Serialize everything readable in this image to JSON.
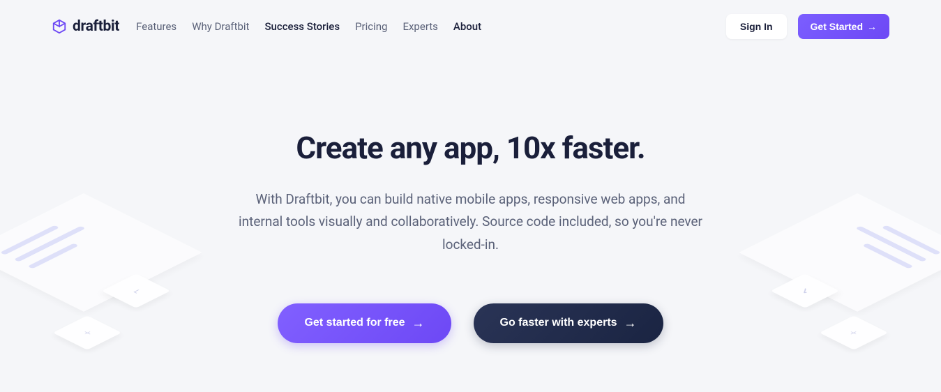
{
  "brand": {
    "name": "draftbit"
  },
  "nav": {
    "items": [
      {
        "label": "Features"
      },
      {
        "label": "Why Draftbit"
      },
      {
        "label": "Success Stories"
      },
      {
        "label": "Pricing"
      },
      {
        "label": "Experts"
      },
      {
        "label": "About"
      }
    ]
  },
  "header": {
    "signin_label": "Sign In",
    "getstarted_label": "Get Started"
  },
  "hero": {
    "title": "Create any app, 10x faster.",
    "subtitle": "With Draftbit, you can build native mobile apps, responsive web apps, and internal tools visually and collaboratively. Source code included, so you're never locked-in.",
    "primary_cta": "Get started for free",
    "secondary_cta": "Go faster with experts"
  }
}
